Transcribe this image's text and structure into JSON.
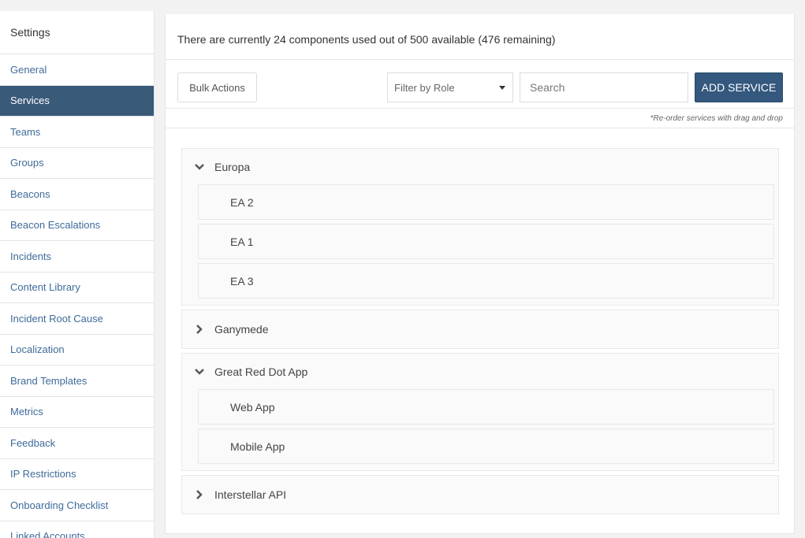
{
  "sidebar": {
    "title": "Settings",
    "items": [
      {
        "label": "General"
      },
      {
        "label": "Services"
      },
      {
        "label": "Teams"
      },
      {
        "label": "Groups"
      },
      {
        "label": "Beacons"
      },
      {
        "label": "Beacon Escalations"
      },
      {
        "label": "Incidents"
      },
      {
        "label": "Content Library"
      },
      {
        "label": "Incident Root Cause"
      },
      {
        "label": "Localization"
      },
      {
        "label": "Brand Templates"
      },
      {
        "label": "Metrics"
      },
      {
        "label": "Feedback"
      },
      {
        "label": "IP Restrictions"
      },
      {
        "label": "Onboarding Checklist"
      },
      {
        "label": "Linked Accounts"
      }
    ],
    "active": "Services"
  },
  "info": {
    "text": "There are currently 24 components used out of 500 available (476 remaining)"
  },
  "toolbar": {
    "bulk_label": "Bulk Actions",
    "filter_value": "Filter by Role",
    "search_placeholder": "Search",
    "add_label": "ADD SERVICE"
  },
  "hint": "*Re-order services with drag and drop",
  "groups": [
    {
      "name": "Europa",
      "expanded": true,
      "children": [
        "EA 2",
        "EA 1",
        "EA 3"
      ]
    },
    {
      "name": "Ganymede",
      "expanded": false,
      "children": []
    },
    {
      "name": "Great Red Dot App",
      "expanded": true,
      "children": [
        "Web App",
        "Mobile App"
      ]
    },
    {
      "name": "Interstellar API",
      "expanded": false,
      "children": []
    }
  ],
  "colors": {
    "accent": "#34587e",
    "sidebar_active": "#3a5a7a",
    "link": "#3f6b9a"
  }
}
